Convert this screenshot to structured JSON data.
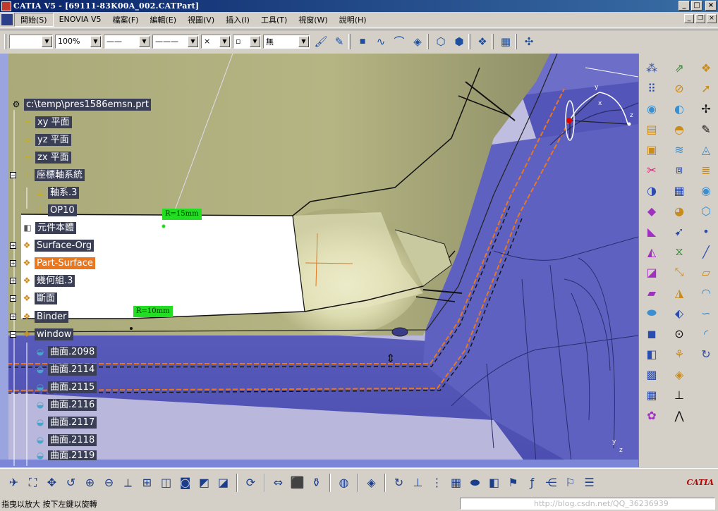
{
  "window": {
    "title": "CATIA V5 - [69111-83K00A_002.CATPart]"
  },
  "menu": {
    "items": [
      "開始(S)",
      "ENOVIA V5",
      "檔案(F)",
      "編輯(E)",
      "視圖(V)",
      "插入(I)",
      "工具(T)",
      "視窗(W)",
      "說明(H)"
    ]
  },
  "format_toolbar": {
    "zoom_value": "100%",
    "cross_symbol": "×",
    "fill_value": "無"
  },
  "spec_tree": {
    "root": "c:\\temp\\pres1586emsn.prt",
    "nodes": [
      {
        "label": "xy 平面",
        "icon": "plane-icon"
      },
      {
        "label": "yz 平面",
        "icon": "plane-icon"
      },
      {
        "label": "zx 平面",
        "icon": "plane-icon"
      },
      {
        "label": "座標軸系統",
        "icon": "axis-system-icon"
      },
      {
        "label": "軸系.3",
        "icon": "axis-icon"
      },
      {
        "label": "OP10",
        "icon": "axis-icon"
      },
      {
        "label": "元件本體",
        "icon": "part-body-icon"
      },
      {
        "label": "Surface-Org",
        "icon": "geometrical-set-icon"
      },
      {
        "label": "Part-Surface",
        "icon": "geometrical-set-icon",
        "selected": true
      },
      {
        "label": "幾何組.3",
        "icon": "geometrical-set-icon"
      },
      {
        "label": "斷面",
        "icon": "geometrical-set-icon"
      },
      {
        "label": "Binder",
        "icon": "geometrical-set-icon"
      },
      {
        "label": "window",
        "icon": "geometrical-set-icon"
      },
      {
        "label": "曲面.2098",
        "icon": "surface-icon"
      },
      {
        "label": "曲面.2114",
        "icon": "surface-icon"
      },
      {
        "label": "曲面.2115",
        "icon": "surface-icon"
      },
      {
        "label": "曲面.2116",
        "icon": "surface-icon"
      },
      {
        "label": "曲面.2117",
        "icon": "surface-icon"
      },
      {
        "label": "曲面.2118",
        "icon": "surface-icon"
      },
      {
        "label": "曲面.2119",
        "icon": "surface-icon"
      }
    ]
  },
  "annotations": {
    "r15": "R=15mm",
    "r10": "R=10mm"
  },
  "compass": {
    "x": "x",
    "y": "y",
    "z": "z"
  },
  "logo": {
    "brand": "CATIA"
  },
  "status": {
    "hint": "指曳以放大 按下左鍵以旋轉",
    "watermark": "http://blog.csdn.net/QQ_36236939"
  },
  "colors": {
    "background": "#bfbee0",
    "surface_olive": "#a3a570",
    "surface_purple": "#5d5fbf",
    "selection": "#e8771f",
    "annotation": "#22dd22"
  }
}
